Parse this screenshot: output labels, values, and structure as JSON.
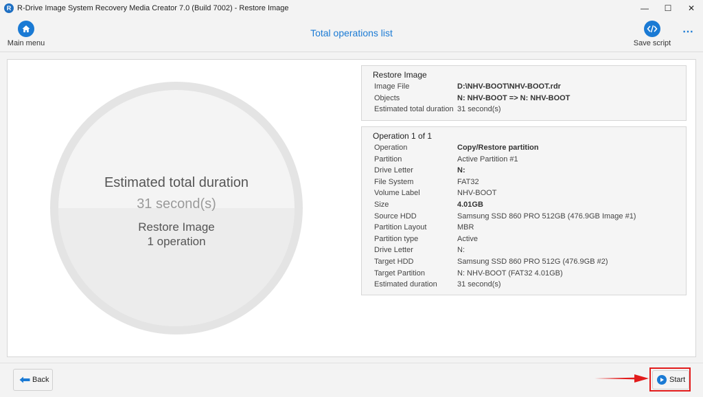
{
  "window": {
    "title": "R-Drive Image System Recovery Media Creator 7.0 (Build 7002) - Restore Image",
    "app_icon_letter": "R",
    "minimize_glyph": "—",
    "maximize_glyph": "☐",
    "close_glyph": "✕"
  },
  "header": {
    "main_menu_label": "Main menu",
    "main_menu_icon": "home-icon",
    "title": "Total operations list",
    "save_script_label": "Save script",
    "save_script_icon": "code-icon",
    "more_glyph": "⋯"
  },
  "summary": {
    "title": "Estimated total duration",
    "duration": "31 second(s)",
    "operation": "Restore Image",
    "count": "1 operation"
  },
  "restore_box": {
    "heading": "Restore Image",
    "rows": [
      {
        "label": "Image File",
        "value": "D:\\NHV-BOOT\\NHV-BOOT.rdr",
        "bold": true
      },
      {
        "label": "Objects",
        "value": "N: NHV-BOOT  => N: NHV-BOOT",
        "bold": true
      },
      {
        "label": "Estimated total duration",
        "value": "31 second(s)",
        "bold": false
      }
    ]
  },
  "operation_box": {
    "heading": "Operation 1 of 1",
    "rows": [
      {
        "label": "Operation",
        "value": "Copy/Restore partition",
        "bold": true
      },
      {
        "label": "Partition",
        "value": "Active Partition #1",
        "bold": false
      },
      {
        "label": "Drive Letter",
        "value": "N:",
        "bold": true
      },
      {
        "label": "File System",
        "value": "FAT32",
        "bold": false
      },
      {
        "label": "Volume Label",
        "value": "NHV-BOOT",
        "bold": false
      },
      {
        "label": "Size",
        "value": "4.01GB",
        "bold": true
      },
      {
        "label": "Source HDD",
        "value": "Samsung SSD 860 PRO 512GB (476.9GB Image #1)",
        "bold": false
      },
      {
        "label": "Partition Layout",
        "value": "MBR",
        "bold": false
      },
      {
        "label": "Partition type",
        "value": "Active",
        "bold": false
      },
      {
        "label": "Drive Letter",
        "value": "N:",
        "bold": false
      },
      {
        "label": "Target HDD",
        "value": "Samsung SSD 860 PRO 512G (476.9GB #2)",
        "bold": false
      },
      {
        "label": "Target Partition",
        "value": "N: NHV-BOOT (FAT32 4.01GB)",
        "bold": false
      },
      {
        "label": "Estimated duration",
        "value": "31 second(s)",
        "bold": false
      }
    ]
  },
  "footer": {
    "back_label": "Back",
    "back_icon": "arrow-left-icon",
    "start_label": "Start",
    "start_icon": "play-icon"
  },
  "colors": {
    "accent": "#1a7ad4",
    "highlight": "#e21b1b"
  }
}
